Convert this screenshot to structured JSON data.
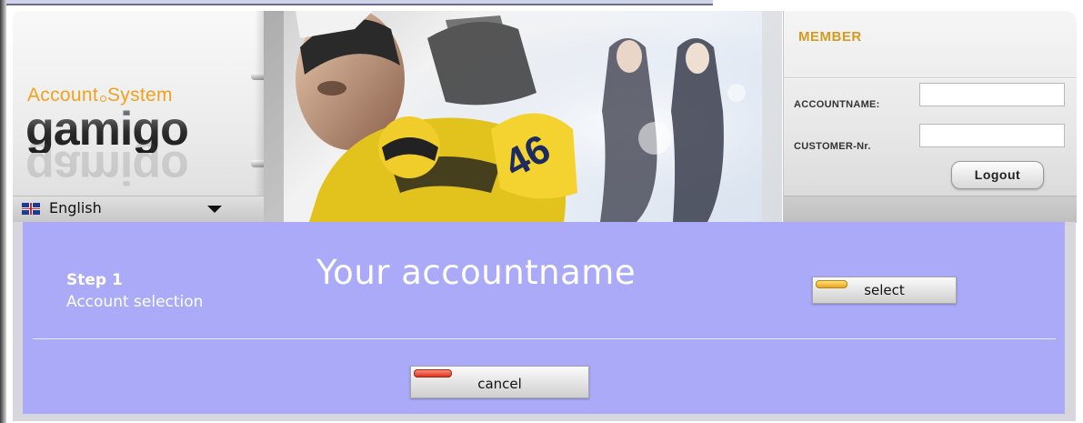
{
  "brand": {
    "tagline_left": "Account",
    "tagline_right": "System",
    "name": "gamigo",
    "accent_color": "#f0a21e"
  },
  "language": {
    "flag_icon": "uk-flag-icon",
    "selected": "English",
    "dropdown_icon": "caret-down-icon"
  },
  "member": {
    "title": "MEMBER",
    "title_color": "#d69a1c",
    "account_label": "ACCOUNTNAME:",
    "account_value": "",
    "customer_label": "CUSTOMER-Nr.",
    "customer_value": "",
    "logout_label": "Logout"
  },
  "content": {
    "background": "#aaaaf8",
    "step_title": "Step 1",
    "step_subtitle": "Account selection",
    "heading": "Your accountname",
    "select_label": "select",
    "cancel_label": "cancel"
  }
}
